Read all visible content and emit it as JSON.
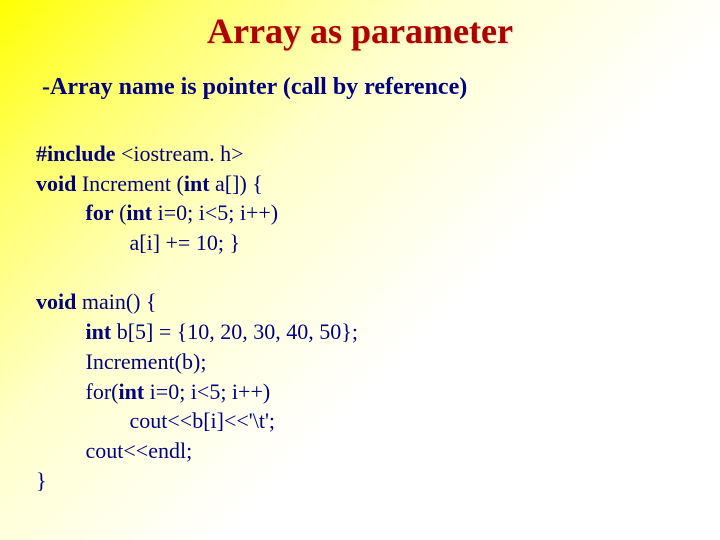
{
  "title": "Array as parameter",
  "subtitle": "-Array name is pointer (call by reference)",
  "code": {
    "include_kw": "#include",
    "include_hdr": " <iostream. h>",
    "void1": "void",
    "inc_sig1": " Increment (",
    "int1": "int",
    "inc_sig2": " a[]) {",
    "for_kw": "for",
    "for_open": " (",
    "int2": "int",
    "for_rest": " i=0; i<5; i++)",
    "inc_body": "                 a[i] += 10; }",
    "void2": "void",
    "main_sig": " main() {",
    "int3": "int",
    "b_decl": " b[5] = {10, 20, 30, 40, 50};",
    "call": "         Increment(b);",
    "for2_pre": "         for(",
    "int4": "int",
    "for2_rest": " i=0; i<5; i++)",
    "cout1": "                 cout<<b[i]<<'\\t';",
    "cout2": "         cout<<endl;",
    "close": "}"
  }
}
